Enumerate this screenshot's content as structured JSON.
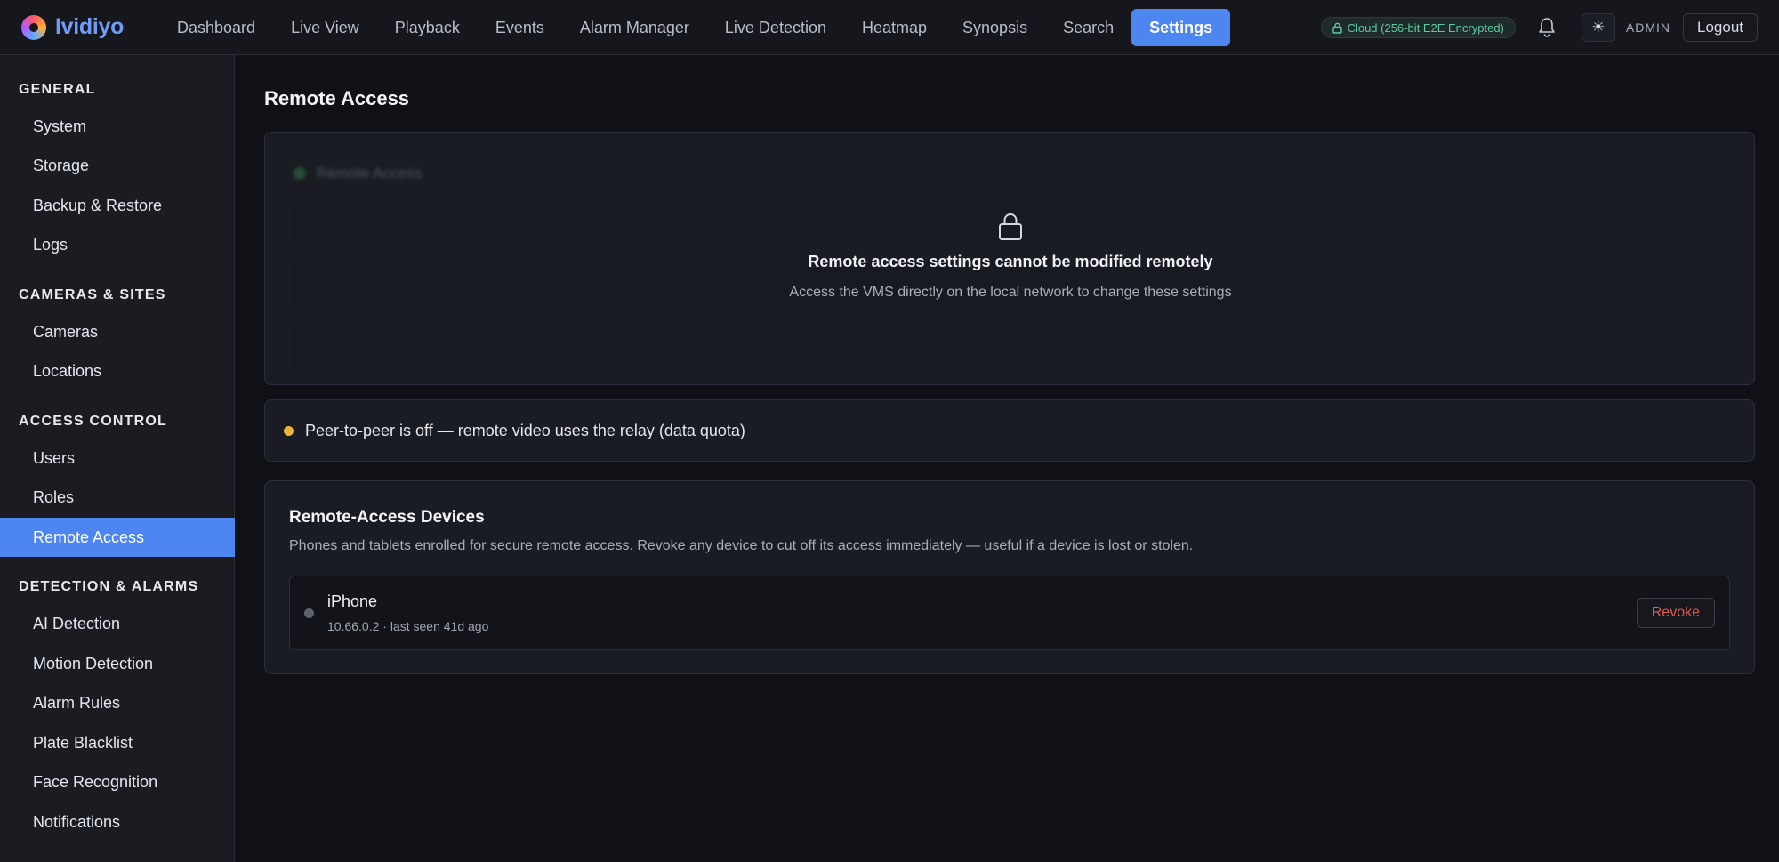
{
  "app": {
    "name": "Ividiyo"
  },
  "nav": {
    "items": [
      {
        "label": "Dashboard"
      },
      {
        "label": "Live View"
      },
      {
        "label": "Playback"
      },
      {
        "label": "Events"
      },
      {
        "label": "Alarm Manager"
      },
      {
        "label": "Live Detection"
      },
      {
        "label": "Heatmap"
      },
      {
        "label": "Synopsis"
      },
      {
        "label": "Search"
      },
      {
        "label": "Settings",
        "active": true
      }
    ]
  },
  "header": {
    "cloud_badge": "Cloud (256-bit E2E Encrypted)",
    "user": "ADMIN",
    "logout_label": "Logout",
    "bell_icon": "bell-icon",
    "theme_icon": "sun-icon"
  },
  "sidebar": {
    "groups": [
      {
        "title": "GENERAL",
        "items": [
          {
            "label": "System"
          },
          {
            "label": "Storage"
          },
          {
            "label": "Backup & Restore"
          },
          {
            "label": "Logs"
          }
        ]
      },
      {
        "title": "CAMERAS & SITES",
        "items": [
          {
            "label": "Cameras"
          },
          {
            "label": "Locations"
          }
        ]
      },
      {
        "title": "ACCESS CONTROL",
        "items": [
          {
            "label": "Users"
          },
          {
            "label": "Roles"
          },
          {
            "label": "Remote Access",
            "active": true
          }
        ]
      },
      {
        "title": "DETECTION & ALARMS",
        "items": [
          {
            "label": "AI Detection"
          },
          {
            "label": "Motion Detection"
          },
          {
            "label": "Alarm Rules"
          },
          {
            "label": "Plate Blacklist"
          },
          {
            "label": "Face Recognition"
          },
          {
            "label": "Notifications"
          }
        ]
      }
    ]
  },
  "main": {
    "title": "Remote Access",
    "locked": {
      "blurred_label": "Remote Access",
      "title": "Remote access settings cannot be modified remotely",
      "subtitle": "Access the VMS directly on the local network to change these settings"
    },
    "p2p": {
      "text": "Peer-to-peer is off — remote video uses the relay (data quota)",
      "status_color": "#f0b33a"
    },
    "devices": {
      "title": "Remote-Access Devices",
      "description": "Phones and tablets enrolled for secure remote access. Revoke any device to cut off its access immediately — useful if a device is lost or stolen.",
      "list": [
        {
          "name": "iPhone",
          "meta": "10.66.0.2 · last seen 41d ago",
          "revoke_label": "Revoke"
        }
      ]
    }
  },
  "colors": {
    "accent": "#4d86f0",
    "danger": "#e05a52",
    "encrypted": "#5fc9a4"
  }
}
